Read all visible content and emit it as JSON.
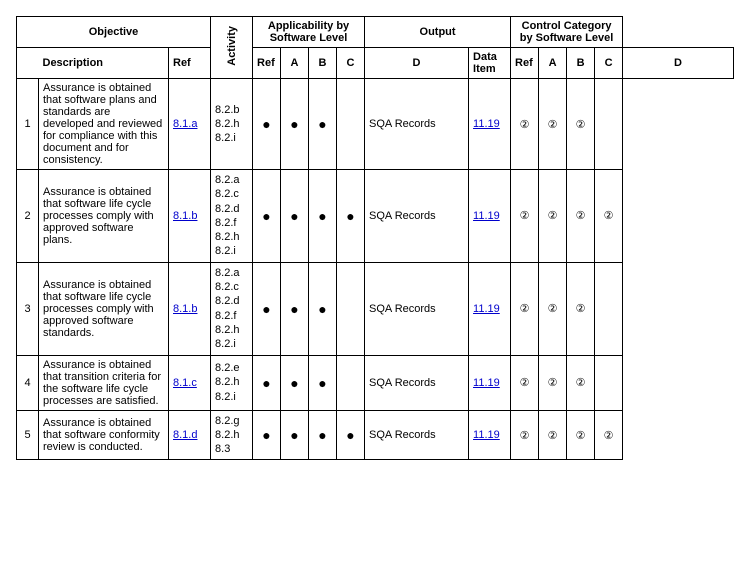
{
  "headers": {
    "objective": "Objective",
    "activity": "Activity",
    "applicability": "Applicability by Software Level",
    "output": "Output",
    "control": "Control Category by Software Level",
    "description": "Description",
    "ref": "Ref",
    "a": "A",
    "b": "B",
    "c": "C",
    "d": "D",
    "data_item": "Data Item"
  },
  "rows": [
    {
      "n": "1",
      "desc": "Assurance is obtained that software plans and standards are developed and reviewed for compliance with this document and for consistency.",
      "ref1": "8.1.a",
      "act": "8.2.b\n8.2.h\n8.2.i",
      "appl": {
        "a": "●",
        "b": "●",
        "c": "●",
        "d": ""
      },
      "di": "SQA Records",
      "ref2": "11.19",
      "cc": {
        "a": "②",
        "b": "②",
        "c": "②",
        "d": ""
      }
    },
    {
      "n": "2",
      "desc": "Assurance is obtained that software life cycle processes comply with approved software plans.",
      "ref1": "8.1.b",
      "act": "8.2.a\n8.2.c\n8.2.d\n8.2.f\n8.2.h\n8.2.i",
      "appl": {
        "a": "●",
        "b": "●",
        "c": "●",
        "d": "●"
      },
      "di": "SQA Records",
      "ref2": "11.19",
      "cc": {
        "a": "②",
        "b": "②",
        "c": "②",
        "d": "②"
      }
    },
    {
      "n": "3",
      "desc": "Assurance is obtained that software life cycle processes comply with approved software standards.",
      "ref1": "8.1.b",
      "act": "8.2.a\n8.2.c\n8.2.d\n8.2.f\n8.2.h\n8.2.i",
      "appl": {
        "a": "●",
        "b": "●",
        "c": "●",
        "d": ""
      },
      "di": "SQA Records",
      "ref2": "11.19",
      "cc": {
        "a": "②",
        "b": "②",
        "c": "②",
        "d": ""
      }
    },
    {
      "n": "4",
      "desc": "Assurance is obtained that transition criteria for the software life cycle processes are satisfied.",
      "ref1": "8.1.c",
      "act": "8.2.e\n8.2.h\n8.2.i",
      "appl": {
        "a": "●",
        "b": "●",
        "c": "●",
        "d": ""
      },
      "di": "SQA Records",
      "ref2": "11.19",
      "cc": {
        "a": "②",
        "b": "②",
        "c": "②",
        "d": ""
      }
    },
    {
      "n": "5",
      "desc": "Assurance is obtained that software conformity review is conducted.",
      "ref1": "8.1.d",
      "act": "8.2.g\n8.2.h\n8.3",
      "appl": {
        "a": "●",
        "b": "●",
        "c": "●",
        "d": "●"
      },
      "di": "SQA Records",
      "ref2": "11.19",
      "cc": {
        "a": "②",
        "b": "②",
        "c": "②",
        "d": "②"
      }
    }
  ]
}
